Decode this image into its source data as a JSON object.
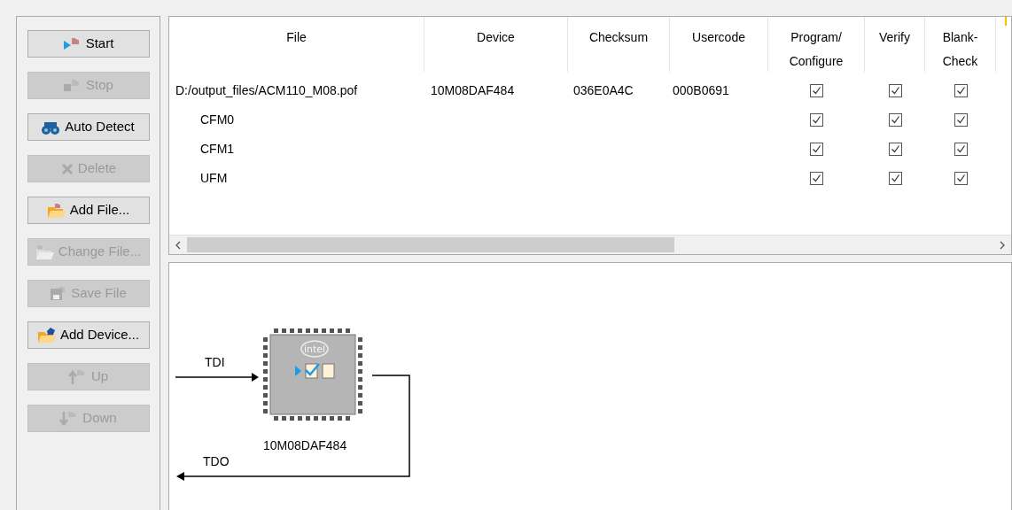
{
  "buttons": [
    {
      "kind": "start",
      "label": "Start",
      "disabled": false
    },
    {
      "kind": "stop",
      "label": "Stop",
      "disabled": true
    },
    {
      "kind": "detect",
      "label": "Auto Detect",
      "disabled": false
    },
    {
      "kind": "delete",
      "label": "Delete",
      "disabled": true
    },
    {
      "kind": "addfile",
      "label": "Add File...",
      "disabled": false
    },
    {
      "kind": "changefile",
      "label": "Change File...",
      "disabled": true
    },
    {
      "kind": "save",
      "label": "Save File",
      "disabled": true
    },
    {
      "kind": "adddevice",
      "label": "Add Device...",
      "disabled": false
    },
    {
      "kind": "up",
      "label": "Up",
      "disabled": true
    },
    {
      "kind": "down",
      "label": "Down",
      "disabled": true
    }
  ],
  "table": {
    "columns": [
      "File",
      "Device",
      "Checksum",
      "Usercode",
      "Program/ Configure",
      "Verify",
      "Blank- Check"
    ],
    "rows": [
      {
        "file": "D:/output_files/ACM110_M08.pof",
        "device": "10M08DAF484",
        "checksum": "036E0A4C",
        "usercode": "000B0691",
        "checks": [
          {
            "checked": true
          },
          {
            "checked": true
          },
          {
            "checked": true
          }
        ],
        "children": [
          {
            "file": "CFM0",
            "checks": [
              {
                "checked": true
              },
              {
                "checked": true
              },
              {
                "checked": true
              }
            ]
          },
          {
            "file": "CFM1",
            "checks": [
              {
                "checked": true
              },
              {
                "checked": true
              },
              {
                "checked": true
              }
            ]
          },
          {
            "file": "UFM",
            "checks": [
              {
                "checked": true
              },
              {
                "checked": true
              },
              {
                "checked": true
              }
            ]
          }
        ]
      }
    ]
  },
  "chain": {
    "tdi": "TDI",
    "tdo": "TDO",
    "chip": {
      "logo": "intel",
      "device": "10M08DAF484"
    }
  }
}
